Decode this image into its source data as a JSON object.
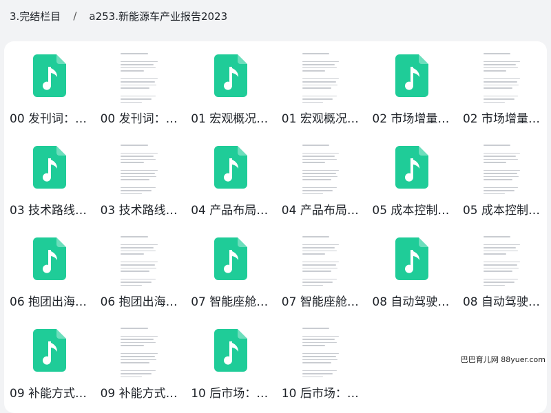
{
  "breadcrumb": {
    "parent": "3.完结栏目",
    "separator": "/",
    "current": "a253.新能源车产业报告2023"
  },
  "files": [
    {
      "name": "00 发刊词：…",
      "kind": "audio"
    },
    {
      "name": "00 发刊词：…",
      "kind": "document"
    },
    {
      "name": "01 宏观概况…",
      "kind": "audio"
    },
    {
      "name": "01 宏观概况…",
      "kind": "document"
    },
    {
      "name": "02 市场增量…",
      "kind": "audio"
    },
    {
      "name": "02 市场增量…",
      "kind": "document"
    },
    {
      "name": "03 技术路线…",
      "kind": "audio"
    },
    {
      "name": "03 技术路线…",
      "kind": "document"
    },
    {
      "name": "04 产品布局…",
      "kind": "audio"
    },
    {
      "name": "04 产品布局…",
      "kind": "document"
    },
    {
      "name": "05 成本控制…",
      "kind": "audio"
    },
    {
      "name": "05 成本控制…",
      "kind": "document"
    },
    {
      "name": "06 抱团出海…",
      "kind": "audio"
    },
    {
      "name": "06 抱团出海…",
      "kind": "document"
    },
    {
      "name": "07 智能座舱…",
      "kind": "audio"
    },
    {
      "name": "07 智能座舱…",
      "kind": "document"
    },
    {
      "name": "08 自动驾驶…",
      "kind": "audio"
    },
    {
      "name": "08 自动驾驶…",
      "kind": "document"
    },
    {
      "name": "09 补能方式…",
      "kind": "audio"
    },
    {
      "name": "09 补能方式…",
      "kind": "document"
    },
    {
      "name": "10 后市场：…",
      "kind": "audio"
    },
    {
      "name": "10 后市场：…",
      "kind": "document"
    }
  ],
  "colors": {
    "audio_icon": "#1fcc98",
    "panel_bg": "#ffffff",
    "page_bg": "#f2f3f5"
  },
  "watermark": "巴巴育儿网 88yuer.com"
}
